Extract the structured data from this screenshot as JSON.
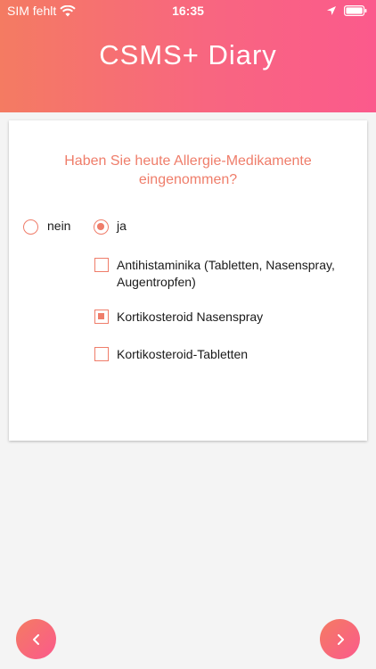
{
  "status_bar": {
    "carrier": "SIM fehlt",
    "time": "16:35",
    "icons": [
      "wifi-icon",
      "location-icon",
      "battery-icon"
    ]
  },
  "header": {
    "title": "CSMS+ Diary"
  },
  "question": {
    "text": "Haben Sie heute Allergie-Medikamente eingenommen?",
    "options": [
      {
        "label": "nein",
        "selected": false
      },
      {
        "label": "ja",
        "selected": true
      }
    ],
    "medications": [
      {
        "label": "Antihistaminika (Tabletten, Nasenspray, Augentropfen)",
        "checked": false
      },
      {
        "label": "Kortikosteroid Nasenspray",
        "checked": true
      },
      {
        "label": "Kortikosteroid-Tabletten",
        "checked": false
      }
    ]
  },
  "navigation": {
    "prev_icon": "chevron-left-icon",
    "next_icon": "chevron-right-icon"
  },
  "colors": {
    "accent": "#ef7d6a",
    "header_start": "#f47b62",
    "header_end": "#fb5a8c",
    "background": "#f4f4f4"
  }
}
